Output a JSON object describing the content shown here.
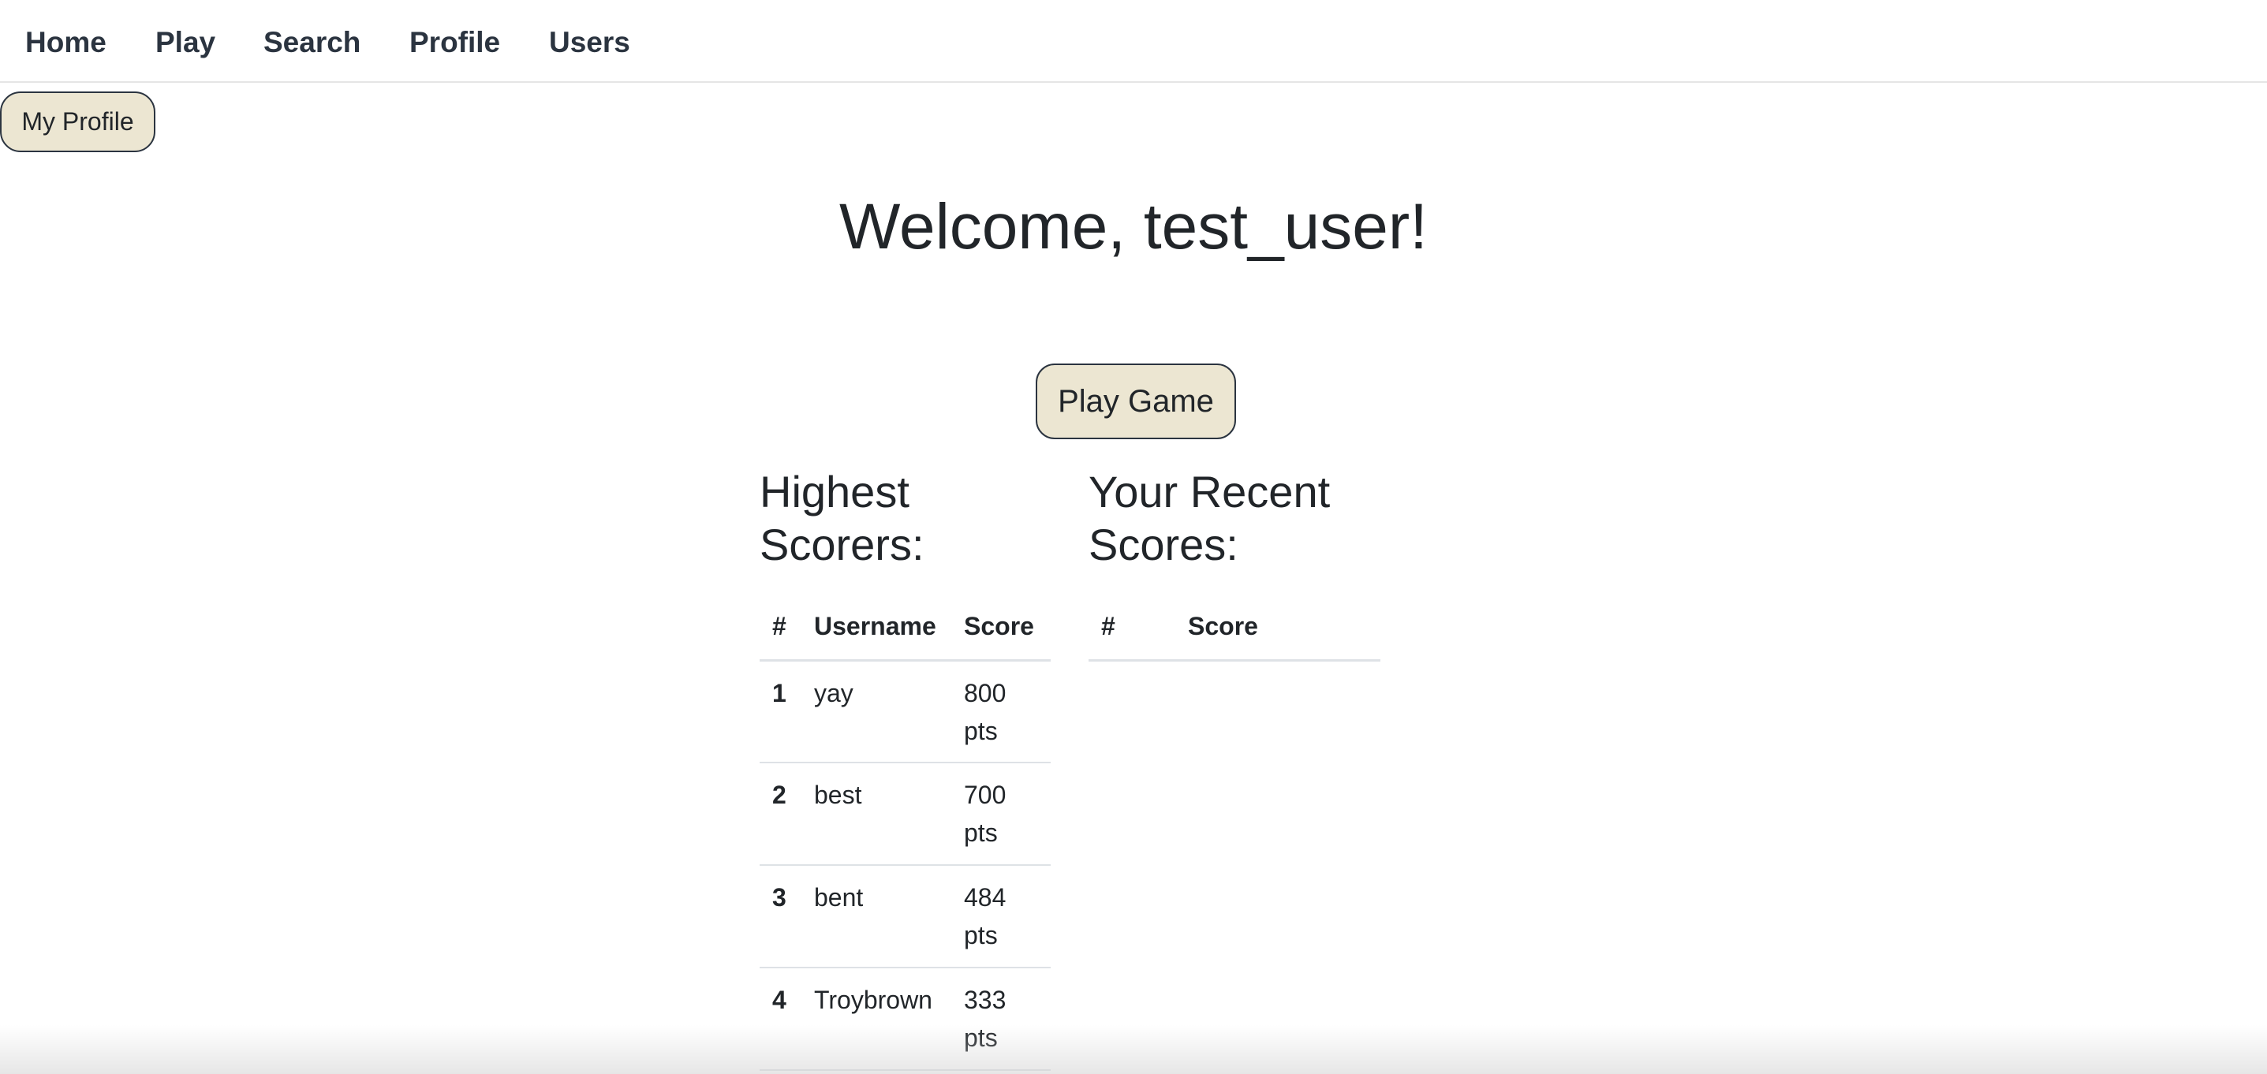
{
  "nav": {
    "items": [
      {
        "label": "Home"
      },
      {
        "label": "Play"
      },
      {
        "label": "Search"
      },
      {
        "label": "Profile"
      },
      {
        "label": "Users"
      }
    ]
  },
  "profile_button": {
    "label": "My Profile"
  },
  "welcome": {
    "text": "Welcome, test_user!"
  },
  "play_button": {
    "label": "Play Game"
  },
  "highest_scorers": {
    "title": "Highest Scorers:",
    "columns": [
      "#",
      "Username",
      "Score"
    ],
    "rows": [
      {
        "rank": "1",
        "username": "yay",
        "score": "800 pts"
      },
      {
        "rank": "2",
        "username": "best",
        "score": "700 pts"
      },
      {
        "rank": "3",
        "username": "bent",
        "score": "484 pts"
      },
      {
        "rank": "4",
        "username": "Troybrown",
        "score": "333 pts"
      }
    ]
  },
  "recent_scores": {
    "title": "Your Recent Scores:",
    "columns": [
      "#",
      "Score"
    ],
    "rows": []
  },
  "colors": {
    "button_bg": "#ece6d2",
    "button_border": "#2b3440",
    "text": "#212529"
  }
}
